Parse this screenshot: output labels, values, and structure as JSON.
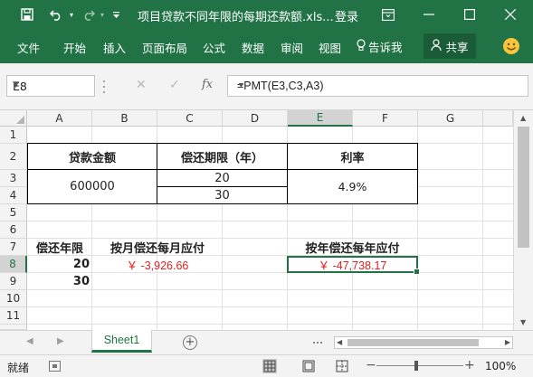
{
  "titlebar": {
    "save_icon": "save-icon",
    "undo_icon": "undo-icon",
    "redo_icon": "redo-icon",
    "customize_icon": "customize-icon",
    "title": "项目贷款不同年限的每期还款额.xls...",
    "login": "登录",
    "ribbon_display_icon": "ribbon-display-options-icon",
    "minimize_icon": "minimize-icon",
    "maximize_icon": "maximize-icon",
    "close_icon": "close-icon"
  },
  "ribbon": {
    "tabs": [
      "文件",
      "开始",
      "插入",
      "页面布局",
      "公式",
      "数据",
      "审阅",
      "视图"
    ],
    "tell_me": "告诉我",
    "share": "共享",
    "feedback_icon": "smiley-icon"
  },
  "formula_bar": {
    "name_box": "E8",
    "formula": "=PMT(E3,C3,A3)"
  },
  "columns": [
    "A",
    "B",
    "C",
    "D",
    "E",
    "F",
    "G"
  ],
  "rows": [
    "1",
    "2",
    "3",
    "4",
    "5",
    "6",
    "7",
    "8",
    "9",
    "10",
    "11"
  ],
  "selected": {
    "column": "E",
    "row": "8"
  },
  "cells": {
    "B2": "贷款金额",
    "D2": "偿还期限（年）",
    "F2": "利率",
    "B3": "600000",
    "D3": "20",
    "D4": "30",
    "F3": "4.9%",
    "A7": "偿还年限",
    "B7": "按月偿还每月应付",
    "F7": "按年偿还每年应付",
    "A8": "20",
    "A9": "30",
    "B8": "￥ -3,926.66",
    "E8": "￥ -47,738.17"
  },
  "sheets": [
    "Sheet1"
  ],
  "status": {
    "ready": "就绪",
    "zoom": "100%"
  },
  "colors": {
    "accent": "#217346",
    "negative": "#e02020"
  }
}
